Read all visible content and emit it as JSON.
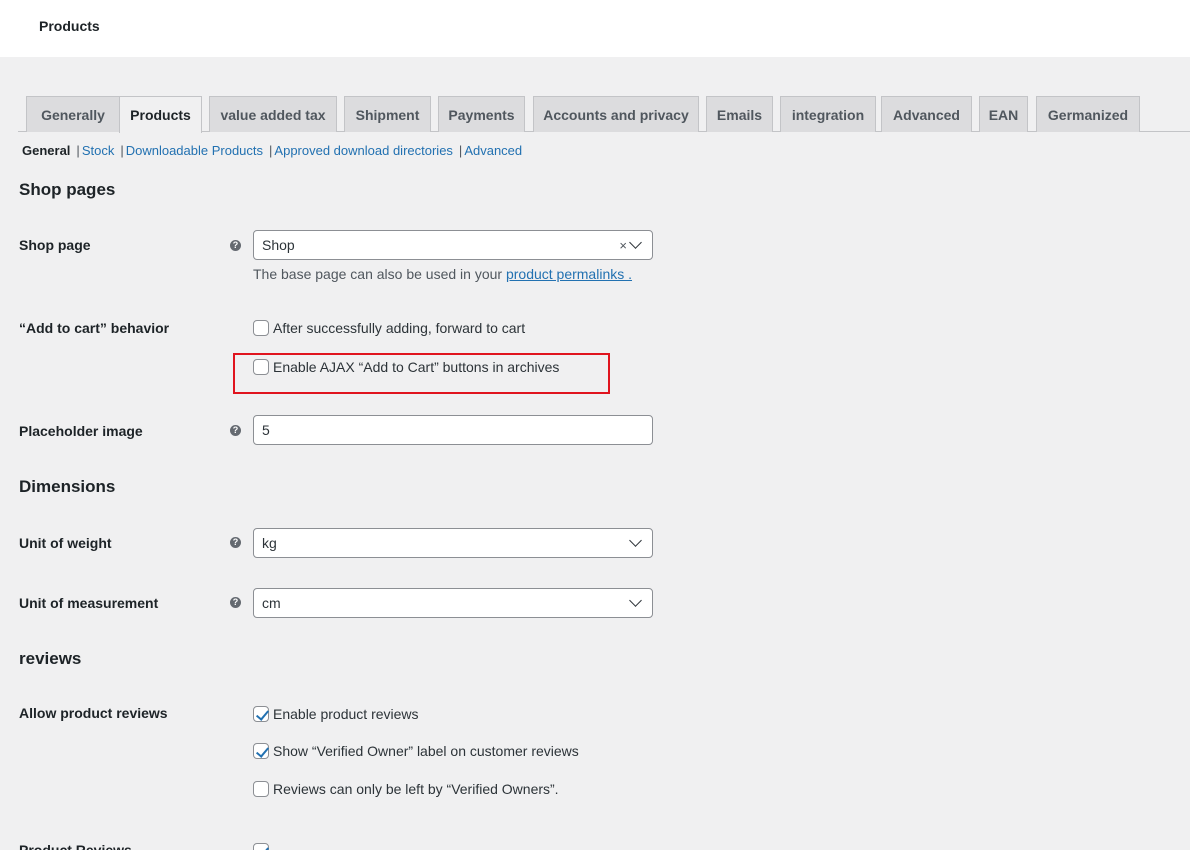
{
  "header": {
    "title": "Products"
  },
  "tabs": [
    {
      "label": "Generally"
    },
    {
      "label": "Products"
    },
    {
      "label": "value added tax"
    },
    {
      "label": "Shipment"
    },
    {
      "label": "Payments"
    },
    {
      "label": "Accounts and privacy"
    },
    {
      "label": "Emails"
    },
    {
      "label": "integration"
    },
    {
      "label": "Advanced"
    },
    {
      "label": "EAN"
    },
    {
      "label": "Germanized"
    }
  ],
  "subnav": {
    "current": "General",
    "links": [
      "Stock",
      "Downloadable Products",
      "Approved download directories",
      "Advanced"
    ],
    "separator": "|"
  },
  "sections": {
    "shop_pages": "Shop pages",
    "dimensions": "Dimensions",
    "reviews": "reviews"
  },
  "shop_page": {
    "label": "Shop page",
    "value": "Shop",
    "clear": "×",
    "desc_prefix": "The base page can also be used in your ",
    "desc_link": "product permalinks ."
  },
  "add_to_cart": {
    "label": "“Add to cart” behavior",
    "option1": "After successfully adding, forward to cart",
    "option2": "Enable AJAX “Add to Cart” buttons in archives"
  },
  "placeholder_image": {
    "label": "Placeholder image",
    "value": "5"
  },
  "unit_weight": {
    "label": "Unit of weight",
    "value": "kg"
  },
  "unit_measurement": {
    "label": "Unit of measurement",
    "value": "cm"
  },
  "allow_reviews": {
    "label": "Allow product reviews",
    "option1": "Enable product reviews",
    "option2": "Show “Verified Owner” label on customer reviews",
    "option3": "Reviews can only be left by “Verified Owners”."
  },
  "product_reviews": {
    "label": "Product Reviews"
  },
  "help_glyph": "?"
}
